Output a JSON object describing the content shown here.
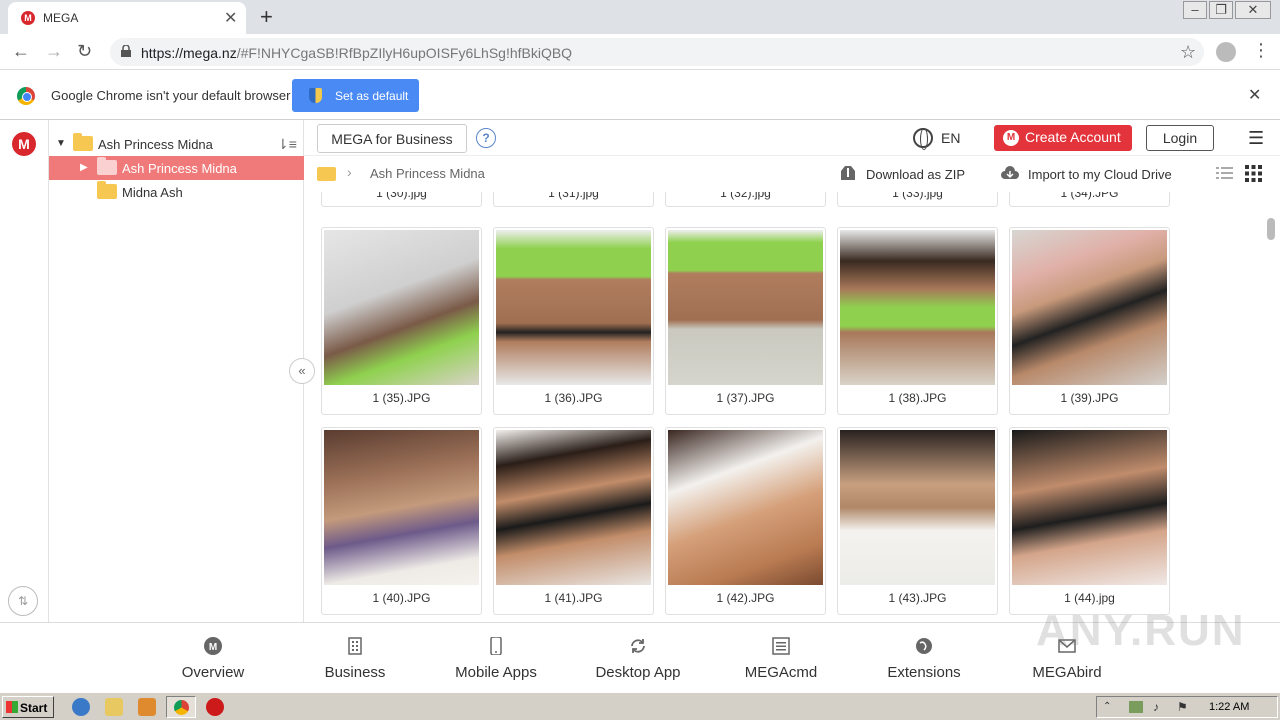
{
  "browser": {
    "tab_title": "MEGA",
    "url_host": "https://mega.nz",
    "url_rest": "/#F!NHYCgaSB!RfBpZIlyH6upOISFy6LhSg!hfBkiQBQ",
    "infobar_text": "Google Chrome isn't your default browser",
    "set_default_label": "Set as default"
  },
  "tree": {
    "root_name": "Ash Princess Midna",
    "items": [
      {
        "name": "Ash Princess Midna"
      },
      {
        "name": "Midna Ash"
      }
    ]
  },
  "topbar": {
    "business_label": "MEGA for Business",
    "help": "?",
    "lang": "EN",
    "create_label": "Create Account",
    "login_label": "Login"
  },
  "breadcrumb": {
    "folder_name": "Ash Princess Midna",
    "download_zip": "Download as ZIP",
    "import_label": "Import to my Cloud Drive"
  },
  "files": {
    "partial_row": [
      "1 (30).jpg",
      "1 (31).jpg",
      "1 (32).jpg",
      "1 (33).jpg",
      "1 (34).JPG"
    ],
    "row1": [
      "1 (35).JPG",
      "1 (36).JPG",
      "1 (37).JPG",
      "1 (38).JPG",
      "1 (39).JPG"
    ],
    "row2": [
      "1 (40).JPG",
      "1 (41).JPG",
      "1 (42).JPG",
      "1 (43).JPG",
      "1 (44).jpg"
    ]
  },
  "footer": {
    "items": [
      {
        "label": "Overview",
        "icon": "mega-icon"
      },
      {
        "label": "Business",
        "icon": "building-icon"
      },
      {
        "label": "Mobile Apps",
        "icon": "phone-icon"
      },
      {
        "label": "Desktop App",
        "icon": "sync-icon"
      },
      {
        "label": "MEGAcmd",
        "icon": "terminal-icon"
      },
      {
        "label": "Extensions",
        "icon": "globe-icon"
      },
      {
        "label": "MEGAbird",
        "icon": "mail-icon"
      }
    ]
  },
  "watermark": "ANY.RUN",
  "taskbar": {
    "start_label": "Start",
    "clock": "1:22 AM"
  },
  "colors": {
    "mega_red": "#d9272e",
    "selected_row": "#f07a7a",
    "chrome_blue": "#4a8af4"
  }
}
